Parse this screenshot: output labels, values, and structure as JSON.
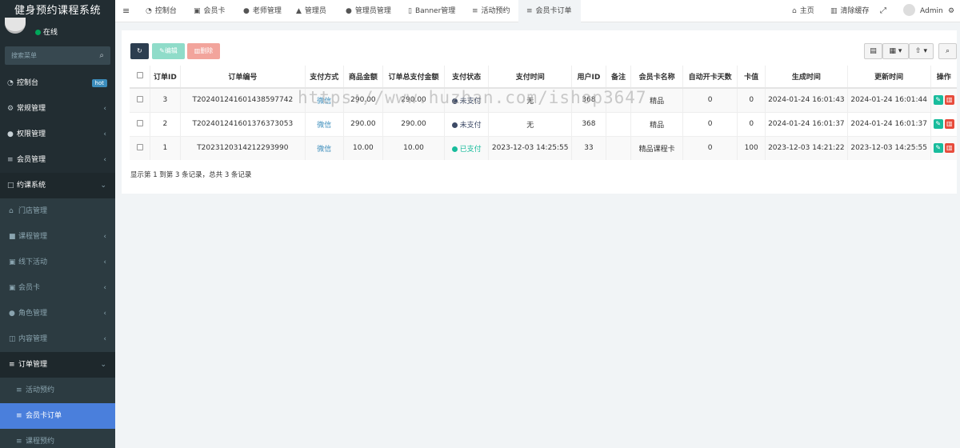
{
  "app": {
    "title": "健身预约课程系统",
    "status": "在线",
    "search_placeholder": "搜索菜单"
  },
  "sidebar": {
    "items": [
      {
        "label": "控制台",
        "icon": "dashboard-icon",
        "badge": "hot"
      },
      {
        "label": "常规管理",
        "icon": "cogs-icon"
      },
      {
        "label": "权限管理",
        "icon": "group-icon"
      },
      {
        "label": "会员管理",
        "icon": "list-icon"
      },
      {
        "label": "约课系统",
        "icon": "folder-open-icon"
      },
      {
        "label": "门店管理",
        "icon": "bank-icon"
      },
      {
        "label": "课程管理",
        "icon": "book-icon"
      },
      {
        "label": "线下活动",
        "icon": "id-card-icon"
      },
      {
        "label": "会员卡",
        "icon": "id-card-icon"
      },
      {
        "label": "角色管理",
        "icon": "users-icon"
      },
      {
        "label": "内容管理",
        "icon": "columns-icon"
      },
      {
        "label": "订单管理",
        "icon": "list-icon"
      },
      {
        "label": "活动预约",
        "icon": "list-icon"
      },
      {
        "label": "会员卡订单",
        "icon": "list-icon"
      },
      {
        "label": "课程预约",
        "icon": "list-icon"
      }
    ]
  },
  "topbar": {
    "tabs": [
      {
        "label": "控制台",
        "icon": "dashboard-icon"
      },
      {
        "label": "会员卡",
        "icon": "id-card-icon"
      },
      {
        "label": "老师管理",
        "icon": "user-icon"
      },
      {
        "label": "管理员",
        "icon": "graduation-cap-icon"
      },
      {
        "label": "管理员管理",
        "icon": "user-icon"
      },
      {
        "label": "Banner管理",
        "icon": "file-icon"
      },
      {
        "label": "活动预约",
        "icon": "list-icon"
      },
      {
        "label": "会员卡订单",
        "icon": "list-icon"
      }
    ],
    "home": "主页",
    "clear_cache": "清除缓存",
    "user": "Admin"
  },
  "toolbar": {
    "edit": "编辑",
    "delete": "删除"
  },
  "table": {
    "headers": [
      "订单ID",
      "订单编号",
      "支付方式",
      "商品金额",
      "订单总支付金额",
      "支付状态",
      "支付时间",
      "用户ID",
      "备注",
      "会员卡名称",
      "自动开卡天数",
      "卡值",
      "生成时间",
      "更新时间",
      "操作"
    ],
    "rows": [
      {
        "id": "3",
        "order_no": "T202401241601438597742",
        "pay_method": "微信",
        "amount": "290.00",
        "total": "290.00",
        "status": "未支付",
        "status_color": "#3d4a66",
        "pay_time": "无",
        "user_id": "368",
        "remark": "",
        "card_name": "精品",
        "auto_days": "0",
        "card_value": "0",
        "created": "2024-01-24 16:01:43",
        "updated": "2024-01-24 16:01:44"
      },
      {
        "id": "2",
        "order_no": "T202401241601376373053",
        "pay_method": "微信",
        "amount": "290.00",
        "total": "290.00",
        "status": "未支付",
        "status_color": "#3d4a66",
        "pay_time": "无",
        "user_id": "368",
        "remark": "",
        "card_name": "精品",
        "auto_days": "0",
        "card_value": "0",
        "created": "2024-01-24 16:01:37",
        "updated": "2024-01-24 16:01:37"
      },
      {
        "id": "1",
        "order_no": "T2023120314212293990",
        "pay_method": "微信",
        "amount": "10.00",
        "total": "10.00",
        "status": "已支付",
        "status_color": "#18bc9c",
        "pay_time": "2023-12-03 14:25:55",
        "user_id": "33",
        "remark": "",
        "card_name": "精品课程卡",
        "auto_days": "0",
        "card_value": "100",
        "created": "2023-12-03 14:21:22",
        "updated": "2023-12-03 14:25:55"
      }
    ]
  },
  "pagination": {
    "summary": "显示第 1 到第 3 条记录，总共 3 条记录"
  },
  "watermark": "https://www.huzhan.com/ishop3647",
  "colors": {
    "sidebar_bg": "#222d32",
    "active": "#4a7fdc",
    "refresh": "#2c3e50",
    "edit": "#18bc9c",
    "delete": "#e74c3c"
  }
}
